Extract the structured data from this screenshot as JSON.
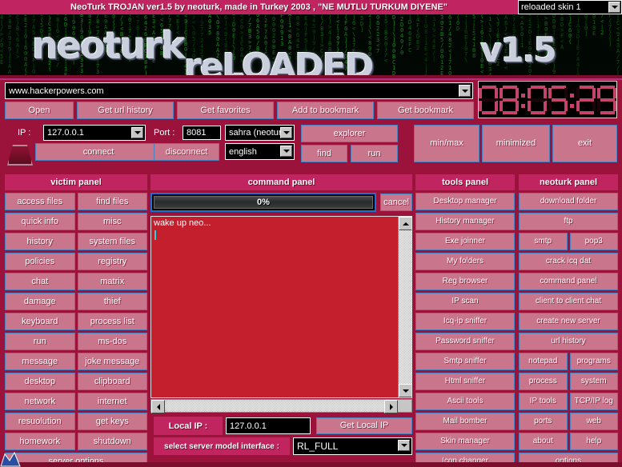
{
  "titlebar": {
    "title": "NeoTurk TROJAN ver1.5 by neoturk, made in Turkey 2003 ,  \"NE MUTLU TURKUM DIYENE\"",
    "skin_selected": "reloaded skin 1"
  },
  "banner": {
    "logo_line1": "neoturk",
    "logo_line2": "reLOADED",
    "logo_line3": "v1.5"
  },
  "url_bar": {
    "value": "www.hackerpowers.com",
    "buttons": [
      "Open",
      "Get url history",
      "Get favorites",
      "Add to bookmark",
      "Get bookmark"
    ]
  },
  "clock": {
    "time": "08:05:29",
    "hours": "08",
    "minutes": "05",
    "seconds": "29"
  },
  "connect": {
    "ip_label": "IP :",
    "ip_value": "127.0.0.1",
    "port_label": "Port :",
    "port_value": "8081",
    "skin_value": "sahra (neotur",
    "lang_value": "english",
    "connect_label": "connect",
    "disconnect_label": "disconnect",
    "explorer_label": "explorer",
    "find_label": "find",
    "run_label": "run",
    "minmax_label": "min/max",
    "minimized_label": "minimized",
    "exit_label": "exit"
  },
  "victim_panel": {
    "title": "victim panel",
    "buttons": [
      "access files",
      "find files",
      "quick info",
      "misc",
      "history",
      "system files",
      "policies",
      "registry",
      "chat",
      "matrix",
      "damage",
      "thief",
      "keyboard",
      "process list",
      "run",
      "ms-dos",
      "message",
      "joke message",
      "desktop",
      "clipboard",
      "network",
      "internet",
      "resuolution",
      "get keys",
      "homework",
      "shutdown"
    ],
    "full_button": "server options"
  },
  "command_panel": {
    "title": "command panel",
    "progress_text": "0%",
    "progress_value": 0,
    "cancel_label": "cancel",
    "console_text": "wake up neo...",
    "local_ip_label": "Local IP :",
    "local_ip_value": "127.0.0.1",
    "get_local_ip_label": "Get Local IP",
    "server_model_label": "select server model interface :",
    "server_model_value": "RL_FULL"
  },
  "tools_panel": {
    "title": "tools panel",
    "buttons": [
      "Desktop manager",
      "History manager",
      "Exe joinner",
      "My folders",
      "Reg browser",
      "IP scan",
      "Icq-ip sniffer",
      "Password sniffer",
      "Smtp sniffer",
      "Html sniffer",
      "Ascii tools",
      "Mail bomber",
      "Skin manager",
      "Icon changer"
    ]
  },
  "neoturk_panel": {
    "title": "neoturk panel",
    "rows": [
      {
        "type": "full",
        "labels": [
          "download folder"
        ]
      },
      {
        "type": "full",
        "labels": [
          "ftp"
        ]
      },
      {
        "type": "half",
        "labels": [
          "smtp",
          "pop3"
        ]
      },
      {
        "type": "full",
        "labels": [
          "crack icq dat"
        ]
      },
      {
        "type": "full",
        "labels": [
          "command panel"
        ]
      },
      {
        "type": "full",
        "labels": [
          "client to client chat"
        ]
      },
      {
        "type": "full",
        "labels": [
          "create new server"
        ]
      },
      {
        "type": "full",
        "labels": [
          "url history"
        ]
      },
      {
        "type": "half",
        "labels": [
          "notepad",
          "programs"
        ]
      },
      {
        "type": "half",
        "labels": [
          "process",
          "system"
        ]
      },
      {
        "type": "half",
        "labels": [
          "IP tools",
          "TCP/IP log"
        ]
      },
      {
        "type": "half",
        "labels": [
          "ports",
          "web"
        ]
      },
      {
        "type": "half",
        "labels": [
          "about",
          "help"
        ]
      },
      {
        "type": "full",
        "labels": [
          "options"
        ]
      }
    ]
  },
  "colors": {
    "background": "#9b123a",
    "header_pink": "#c0255f",
    "button_face": "#c9768c",
    "button_border": "#4a7fc0",
    "console_red": "#c41f2d",
    "clock_segment": "#c2436c",
    "matrix_green": "#17a01c"
  }
}
